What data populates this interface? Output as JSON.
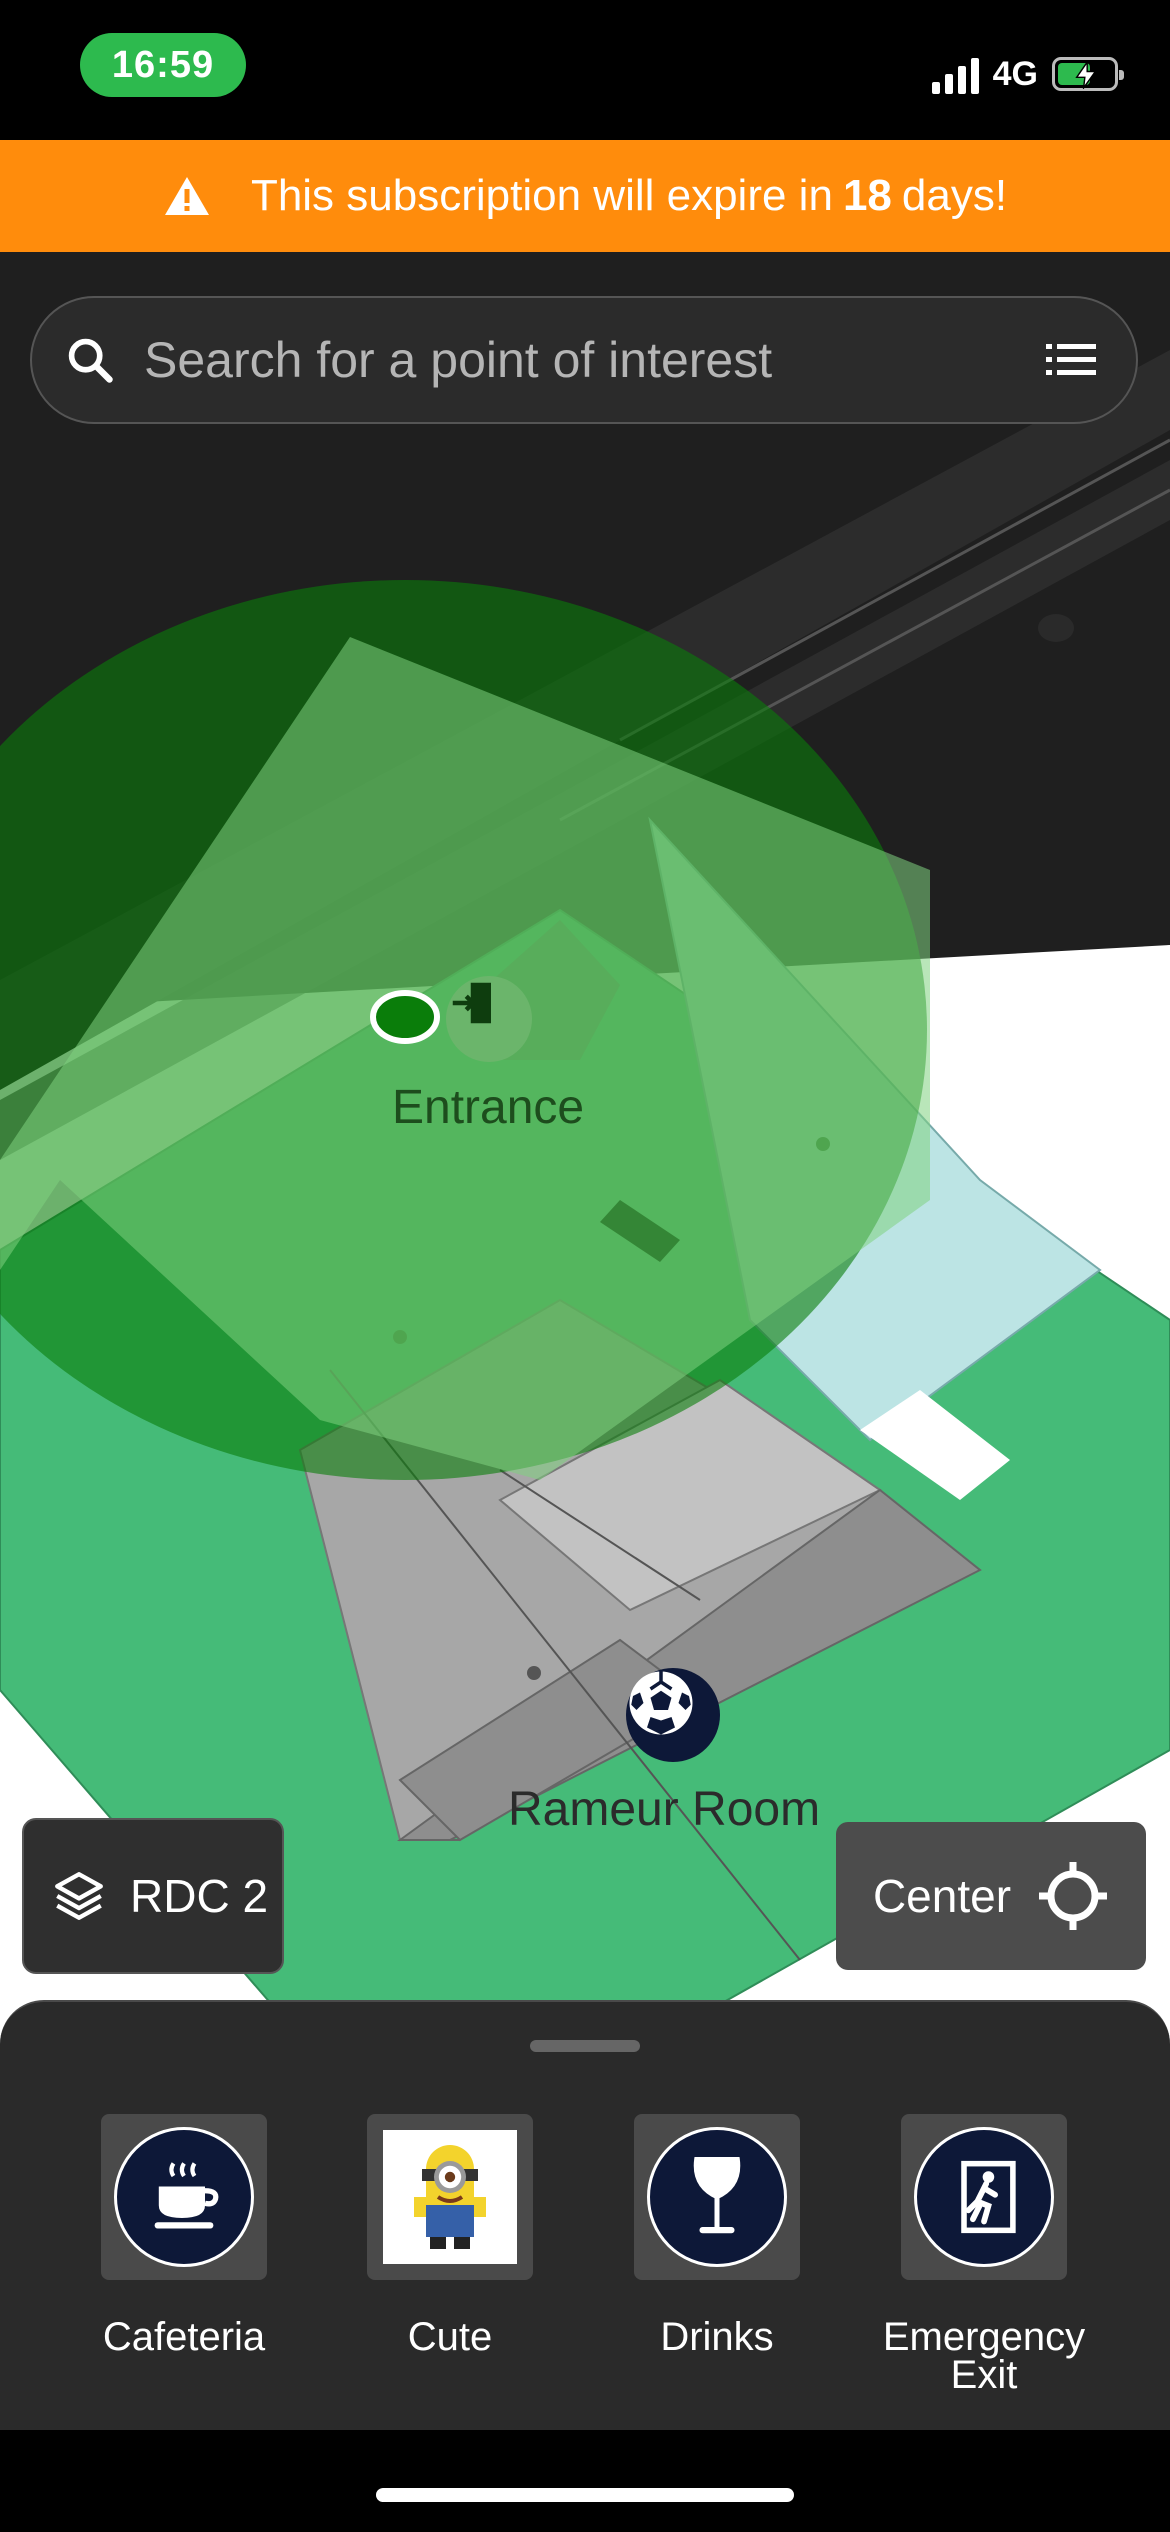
{
  "colors": {
    "accent_green": "#2dba4e",
    "banner_orange": "#ff8c0c",
    "poi_navy": "#0d1838",
    "location_green": "#0a7d0a"
  },
  "status_bar": {
    "time": "16:59",
    "network": "4G",
    "battery_level": 0.6
  },
  "banner": {
    "text_before": "This subscription will expire in",
    "days": "18",
    "text_after": "days!",
    "icon": "warning-icon"
  },
  "search": {
    "placeholder": "Search for a point of interest",
    "value": "",
    "icon": "search-icon",
    "menu_icon": "list-icon"
  },
  "map": {
    "pois": [
      {
        "label": "Entrance",
        "icon": "entrance-icon"
      },
      {
        "label": "Rameur Room",
        "icon": "soccer-ball-icon"
      }
    ]
  },
  "floor_selector": {
    "label": "RDC 2",
    "icon": "layers-icon"
  },
  "center_button": {
    "label": "Center",
    "icon": "crosshair-icon"
  },
  "categories": [
    {
      "label": "Cafeteria",
      "icon": "coffee-cup-icon"
    },
    {
      "label": "Cute",
      "icon": "minion-icon"
    },
    {
      "label": "Drinks",
      "icon": "wine-glass-icon"
    },
    {
      "label": "Emergency Exit",
      "icon": "emergency-exit-icon"
    }
  ]
}
